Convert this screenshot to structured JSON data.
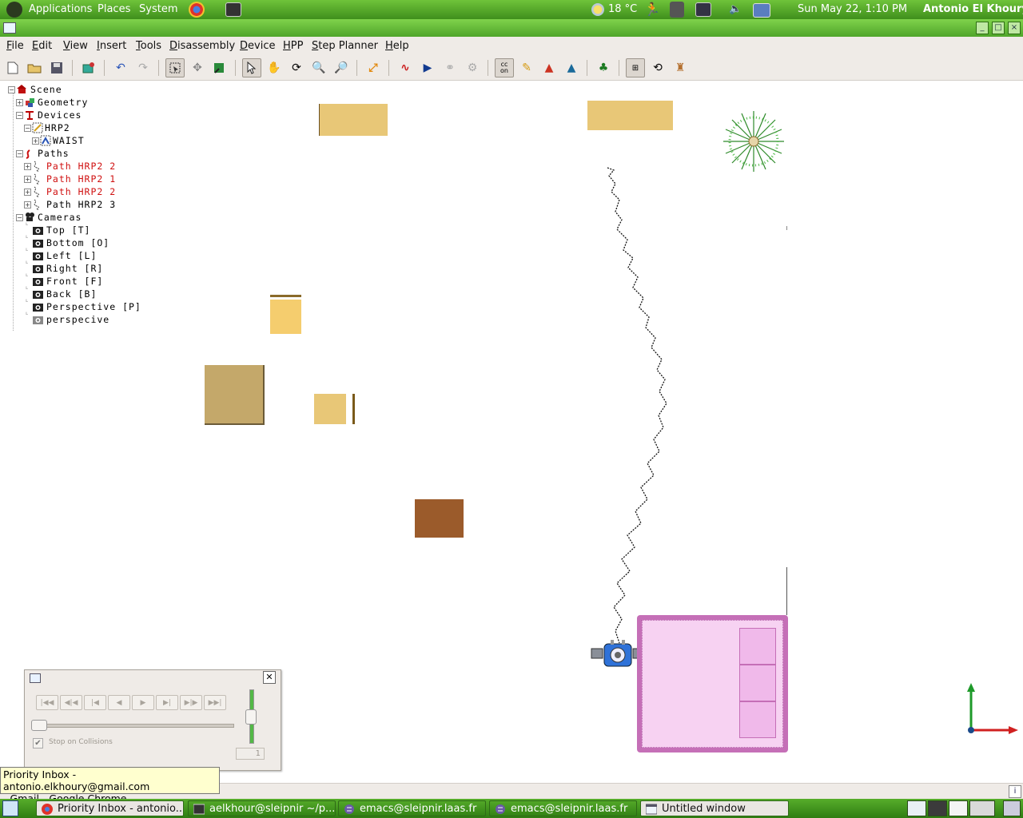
{
  "top_panel": {
    "menus": [
      "Applications",
      "Places",
      "System"
    ],
    "weather": "18 °C",
    "clock": "Sun May 22,  1:10 PM",
    "user": "Antonio El Khoury"
  },
  "menubar": {
    "items": [
      "File",
      "Edit",
      "View",
      "Insert",
      "Tools",
      "Disassembly",
      "Device",
      "HPP",
      "Step Planner",
      "Help"
    ]
  },
  "toolbar": {
    "icons": [
      "new-file-icon",
      "open-file-icon",
      "save-icon",
      "import-icon",
      "undo-icon",
      "redo-icon",
      "select-mode-icon",
      "move-icon",
      "transform-icon",
      "pointer-icon",
      "hand-icon",
      "rotate-icon",
      "zoom-icon",
      "zoom-fit-icon",
      "resize-icon",
      "curve-icon",
      "play-icon",
      "link-icon",
      "gear-icon",
      "collision-on-icon",
      "ruler-icon",
      "tree-red-icon",
      "tree-blue-icon",
      "tree-green-icon",
      "frames-icon",
      "refresh-icon",
      "robot-icon"
    ]
  },
  "tree": {
    "scene": "Scene",
    "geometry": "Geometry",
    "devices": "Devices",
    "hrp2": "HRP2",
    "waist": "WAIST",
    "paths": "Paths",
    "path_items": [
      {
        "label": "Path HRP2 2",
        "color": "#d01010"
      },
      {
        "label": "Path HRP2 1",
        "color": "#d01010"
      },
      {
        "label": "Path HRP2 2",
        "color": "#d01010"
      },
      {
        "label": "Path HRP2 3",
        "color": "#000000"
      }
    ],
    "cameras": "Cameras",
    "camera_items": [
      "Top [T]",
      "Bottom [O]",
      "Left [L]",
      "Right [R]",
      "Front [F]",
      "Back [B]",
      "Perspective [P]",
      "perspecive"
    ]
  },
  "player": {
    "buttons": [
      "first-frame-button",
      "step-back-fast-button",
      "step-back-button",
      "play-backward-button",
      "play-forward-button",
      "step-forward-button",
      "step-forward-fast-button",
      "last-frame-button"
    ],
    "stop_on_collisions_label": "Stop on Collisions",
    "stop_on_collisions_checked": true,
    "speed_value": "1"
  },
  "tooltip": {
    "line1": "Priority Inbox - antonio.elkhoury@gmail.com",
    "line2": "- Gmail - Google Chrome"
  },
  "taskbar": {
    "items": [
      {
        "label": "Priority Inbox - antonio...",
        "icon": "chrome-icon",
        "active": true
      },
      {
        "label": "aelkhour@sleipnir ~/p...",
        "icon": "terminal-icon",
        "active": false
      },
      {
        "label": "emacs@sleipnir.laas.fr",
        "icon": "emacs-icon",
        "active": false
      },
      {
        "label": "emacs@sleipnir.laas.fr",
        "icon": "emacs-icon",
        "active": false
      },
      {
        "label": "Untitled window",
        "icon": "window-icon",
        "active": true
      }
    ]
  },
  "colors": {
    "panel_green": "#4fa52a",
    "table_light": "#e8c777",
    "table_dark": "#c4a86a",
    "table_brown": "#9b5b2b",
    "bed_pink": "#f3c8f0",
    "bed_frame": "#c56fb7",
    "path_red": "#d01010"
  }
}
